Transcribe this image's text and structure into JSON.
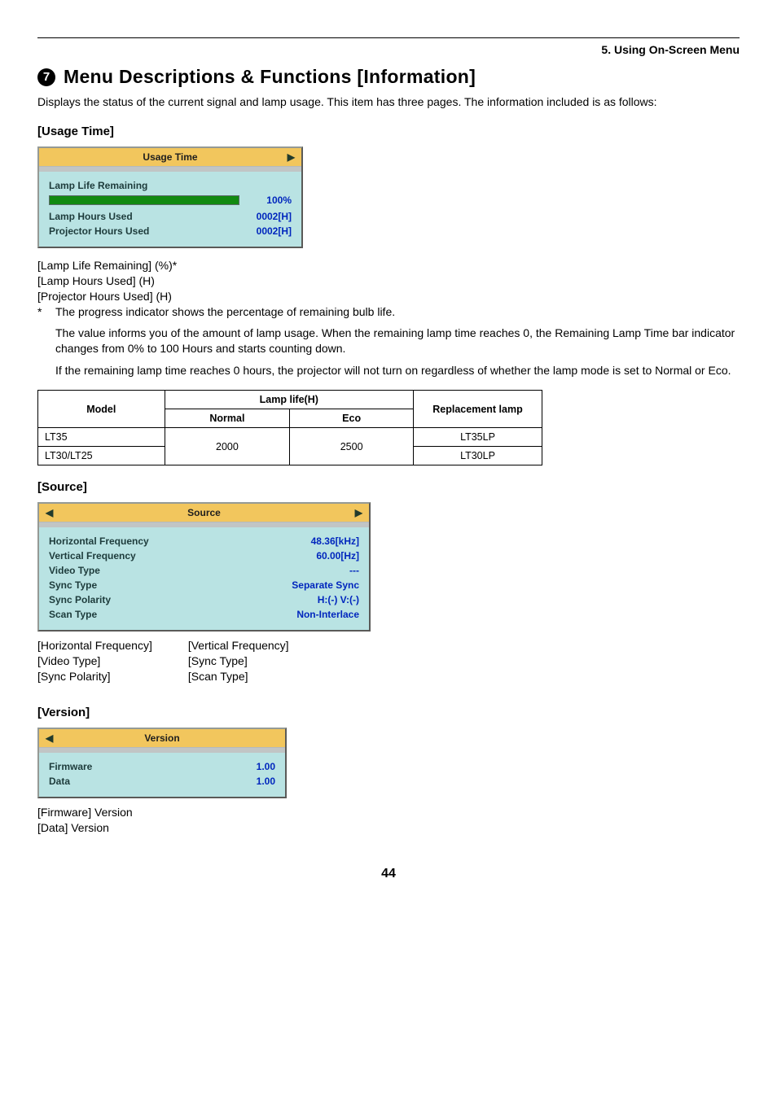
{
  "chapter": "5. Using On-Screen Menu",
  "section_number": "7",
  "section_title": "Menu Descriptions & Functions [Information]",
  "intro": "Displays the status of the current signal and lamp usage. This item has three pages. The information included is as follows:",
  "usage_time": {
    "heading": "[Usage Time]",
    "osd_title": "Usage Time",
    "rows": {
      "lamp_life_remaining_label": "Lamp Life Remaining",
      "lamp_life_remaining_value": "100%",
      "lamp_hours_used_label": "Lamp Hours Used",
      "lamp_hours_used_value": "0002[H]",
      "projector_hours_used_label": "Projector Hours Used",
      "projector_hours_used_value": "0002[H]"
    },
    "desc_lines": [
      "[Lamp Life Remaining] (%)*",
      "[Lamp Hours Used] (H)",
      "[Projector Hours Used] (H)"
    ],
    "footnote_mark": "*",
    "footnote_text": "The progress indicator shows the percentage of remaining bulb life.",
    "note_para_1": "The value informs you of the amount of lamp usage. When the remaining lamp time reaches 0, the Remaining Lamp Time bar indicator changes from 0% to 100 Hours and starts counting down.",
    "note_para_2": "If the remaining lamp time reaches 0 hours, the projector will not turn on regardless of whether the lamp mode is set to Normal or Eco."
  },
  "lamp_table": {
    "headers": {
      "model": "Model",
      "lamp_life": "Lamp life(H)",
      "normal": "Normal",
      "eco": "Eco",
      "replacement": "Replacement lamp"
    },
    "rows": [
      {
        "model": "LT35",
        "normal": "2000",
        "eco": "2500",
        "replacement": "LT35LP"
      },
      {
        "model": "LT30/LT25",
        "normal": "",
        "eco": "",
        "replacement": "LT30LP"
      }
    ]
  },
  "source": {
    "heading": "[Source]",
    "osd_title": "Source",
    "rows": [
      {
        "label": "Horizontal Frequency",
        "value": "48.36[kHz]"
      },
      {
        "label": "Vertical Frequency",
        "value": "60.00[Hz]"
      },
      {
        "label": "Video Type",
        "value": "---"
      },
      {
        "label": "Sync Type",
        "value": "Separate Sync"
      },
      {
        "label": "Sync Polarity",
        "value": "H:(-) V:(-)"
      },
      {
        "label": "Scan Type",
        "value": "Non-Interlace"
      }
    ],
    "legend": {
      "col1": [
        "[Horizontal Frequency]",
        "[Video Type]",
        "[Sync Polarity]"
      ],
      "col2": [
        "[Vertical Frequency]",
        "[Sync Type]",
        "[Scan Type]"
      ]
    }
  },
  "version": {
    "heading": "[Version]",
    "osd_title": "Version",
    "rows": [
      {
        "label": "Firmware",
        "value": "1.00"
      },
      {
        "label": "Data",
        "value": "1.00"
      }
    ],
    "legend": [
      "[Firmware] Version",
      "[Data] Version"
    ]
  },
  "page_number": "44"
}
